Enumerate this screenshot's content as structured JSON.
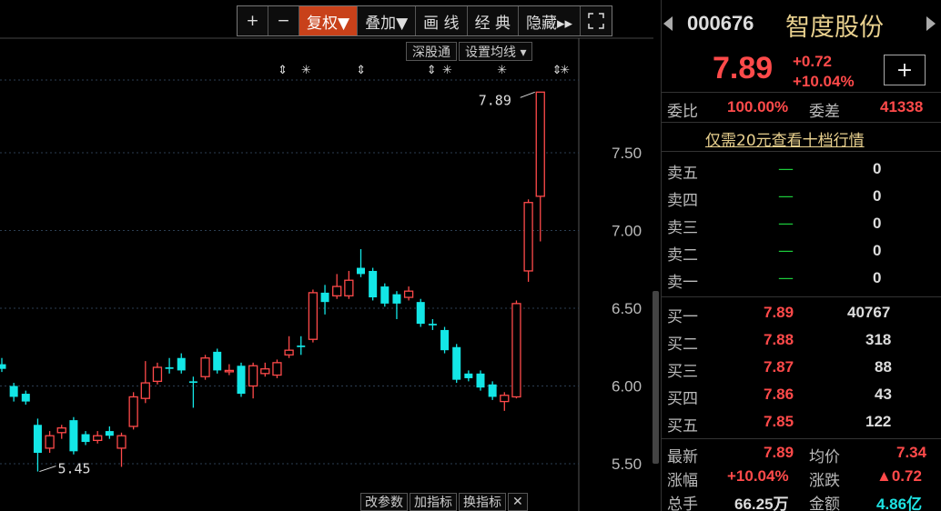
{
  "toolbar": {
    "plus": "+",
    "minus": "−",
    "fuquan": "复权▼",
    "diejia": "叠加▼",
    "huaxian": "画 线",
    "jingdian": "经 典",
    "yincang": "隐藏▸▸"
  },
  "sub_toolbar": {
    "shengutong": "深股通",
    "setma": "设置均线 ▾"
  },
  "bottom_bar": {
    "gaicanshu": "改参数",
    "jiazhibiao": "加指标",
    "huanzhibiao": "换指标",
    "close": "✕"
  },
  "chart_data": {
    "type": "candlestick",
    "ylim": [
      5.38,
      8.0
    ],
    "yticks": [
      "7.50",
      "7.00",
      "6.50",
      "6.00",
      "5.50"
    ],
    "ytick_values": [
      7.5,
      7.0,
      6.5,
      6.0,
      5.5
    ],
    "annotations": {
      "high": "7.89",
      "low": "5.45",
      "high_value": 7.89,
      "low_value": 5.45
    },
    "candles": [
      {
        "o": 6.14,
        "c": 6.11,
        "h": 6.18,
        "l": 6.09
      },
      {
        "o": 6.0,
        "c": 5.93,
        "h": 6.02,
        "l": 5.9
      },
      {
        "o": 5.95,
        "c": 5.9,
        "h": 5.97,
        "l": 5.88
      },
      {
        "o": 5.75,
        "c": 5.57,
        "h": 5.79,
        "l": 5.45
      },
      {
        "o": 5.6,
        "c": 5.68,
        "h": 5.71,
        "l": 5.57
      },
      {
        "o": 5.7,
        "c": 5.73,
        "h": 5.75,
        "l": 5.66
      },
      {
        "o": 5.78,
        "c": 5.58,
        "h": 5.8,
        "l": 5.56
      },
      {
        "o": 5.69,
        "c": 5.64,
        "h": 5.71,
        "l": 5.62
      },
      {
        "o": 5.65,
        "c": 5.68,
        "h": 5.71,
        "l": 5.63
      },
      {
        "o": 5.71,
        "c": 5.68,
        "h": 5.74,
        "l": 5.66
      },
      {
        "o": 5.6,
        "c": 5.68,
        "h": 5.7,
        "l": 5.48
      },
      {
        "o": 5.74,
        "c": 5.93,
        "h": 5.96,
        "l": 5.72
      },
      {
        "o": 5.92,
        "c": 6.02,
        "h": 6.16,
        "l": 5.89
      },
      {
        "o": 6.03,
        "c": 6.12,
        "h": 6.15,
        "l": 6.01
      },
      {
        "o": 6.12,
        "c": 6.11,
        "h": 6.18,
        "l": 6.08
      },
      {
        "o": 6.18,
        "c": 6.1,
        "h": 6.21,
        "l": 6.08
      },
      {
        "o": 6.03,
        "c": 6.02,
        "h": 6.06,
        "l": 5.86
      },
      {
        "o": 6.06,
        "c": 6.18,
        "h": 6.2,
        "l": 6.04
      },
      {
        "o": 6.22,
        "c": 6.1,
        "h": 6.24,
        "l": 6.08
      },
      {
        "o": 6.1,
        "c": 6.1,
        "h": 6.14,
        "l": 6.07
      },
      {
        "o": 6.13,
        "c": 5.95,
        "h": 6.15,
        "l": 5.93
      },
      {
        "o": 6.0,
        "c": 6.13,
        "h": 6.15,
        "l": 5.92
      },
      {
        "o": 6.08,
        "c": 6.11,
        "h": 6.15,
        "l": 6.06
      },
      {
        "o": 6.07,
        "c": 6.15,
        "h": 6.17,
        "l": 6.05
      },
      {
        "o": 6.2,
        "c": 6.23,
        "h": 6.32,
        "l": 6.18
      },
      {
        "o": 6.26,
        "c": 6.25,
        "h": 6.32,
        "l": 6.2
      },
      {
        "o": 6.3,
        "c": 6.6,
        "h": 6.62,
        "l": 6.28
      },
      {
        "o": 6.6,
        "c": 6.54,
        "h": 6.65,
        "l": 6.46
      },
      {
        "o": 6.58,
        "c": 6.64,
        "h": 6.72,
        "l": 6.56
      },
      {
        "o": 6.58,
        "c": 6.68,
        "h": 6.74,
        "l": 6.56
      },
      {
        "o": 6.76,
        "c": 6.72,
        "h": 6.88,
        "l": 6.7
      },
      {
        "o": 6.74,
        "c": 6.57,
        "h": 6.76,
        "l": 6.55
      },
      {
        "o": 6.64,
        "c": 6.53,
        "h": 6.66,
        "l": 6.51
      },
      {
        "o": 6.59,
        "c": 6.53,
        "h": 6.61,
        "l": 6.43
      },
      {
        "o": 6.57,
        "c": 6.61,
        "h": 6.64,
        "l": 6.55
      },
      {
        "o": 6.54,
        "c": 6.4,
        "h": 6.56,
        "l": 6.38
      },
      {
        "o": 6.4,
        "c": 6.39,
        "h": 6.43,
        "l": 6.36
      },
      {
        "o": 6.36,
        "c": 6.23,
        "h": 6.38,
        "l": 6.21
      },
      {
        "o": 6.25,
        "c": 6.04,
        "h": 6.27,
        "l": 6.02
      },
      {
        "o": 6.08,
        "c": 6.05,
        "h": 6.1,
        "l": 6.03
      },
      {
        "o": 6.08,
        "c": 5.99,
        "h": 6.1,
        "l": 5.97
      },
      {
        "o": 6.01,
        "c": 5.93,
        "h": 6.03,
        "l": 5.91
      },
      {
        "o": 5.9,
        "c": 5.94,
        "h": 5.96,
        "l": 5.84
      },
      {
        "o": 5.93,
        "c": 6.53,
        "h": 6.55,
        "l": 5.92
      },
      {
        "o": 6.74,
        "c": 7.18,
        "h": 7.2,
        "l": 6.67
      },
      {
        "o": 7.22,
        "c": 7.89,
        "h": 7.89,
        "l": 6.93
      }
    ],
    "marker_row": [
      {
        "idx": 14,
        "sym": "⇕"
      },
      {
        "idx": 17,
        "sym": "✳"
      },
      {
        "idx": 24,
        "sym": "⇕"
      },
      {
        "idx": 33,
        "sym": "⇕"
      },
      {
        "idx": 35,
        "sym": "✳"
      },
      {
        "idx": 42,
        "sym": "✳"
      },
      {
        "idx": 49,
        "sym": "⇕"
      },
      {
        "idx": 50,
        "sym": "✳"
      }
    ],
    "up_color": "#ff4a4a",
    "down_color": "#13e6e6",
    "grid": true,
    "grid_color": "#2c3e52"
  },
  "quote": {
    "code": "000676",
    "name": "智度股份",
    "price": "7.89",
    "change": "+0.72",
    "change_pct": "+10.04%",
    "plus_label": "+",
    "weibi_label": "委比",
    "weibi": "100.00%",
    "weicha_label": "委差",
    "weicha": "41338",
    "promo": "仅需20元查看十档行情",
    "sell": [
      {
        "label": "卖五",
        "price": "—",
        "vol": "0"
      },
      {
        "label": "卖四",
        "price": "—",
        "vol": "0"
      },
      {
        "label": "卖三",
        "price": "—",
        "vol": "0"
      },
      {
        "label": "卖二",
        "price": "—",
        "vol": "0"
      },
      {
        "label": "卖一",
        "price": "—",
        "vol": "0"
      }
    ],
    "buy": [
      {
        "label": "买一",
        "price": "7.89",
        "vol": "40767"
      },
      {
        "label": "买二",
        "price": "7.88",
        "vol": "318"
      },
      {
        "label": "买三",
        "price": "7.87",
        "vol": "88"
      },
      {
        "label": "买四",
        "price": "7.86",
        "vol": "43"
      },
      {
        "label": "买五",
        "price": "7.85",
        "vol": "122"
      }
    ],
    "stats": {
      "zuixin_label": "最新",
      "zuixin": "7.89",
      "junjia_label": "均价",
      "junjia": "7.34",
      "zhangfu_label": "涨幅",
      "zhangfu": "+10.04%",
      "zhangdie_label": "涨跌",
      "zhangdie": "▲0.72",
      "zongshou_label": "总手",
      "zongshou": "66.25万",
      "jine_label": "金额",
      "jine": "4.86亿"
    }
  }
}
